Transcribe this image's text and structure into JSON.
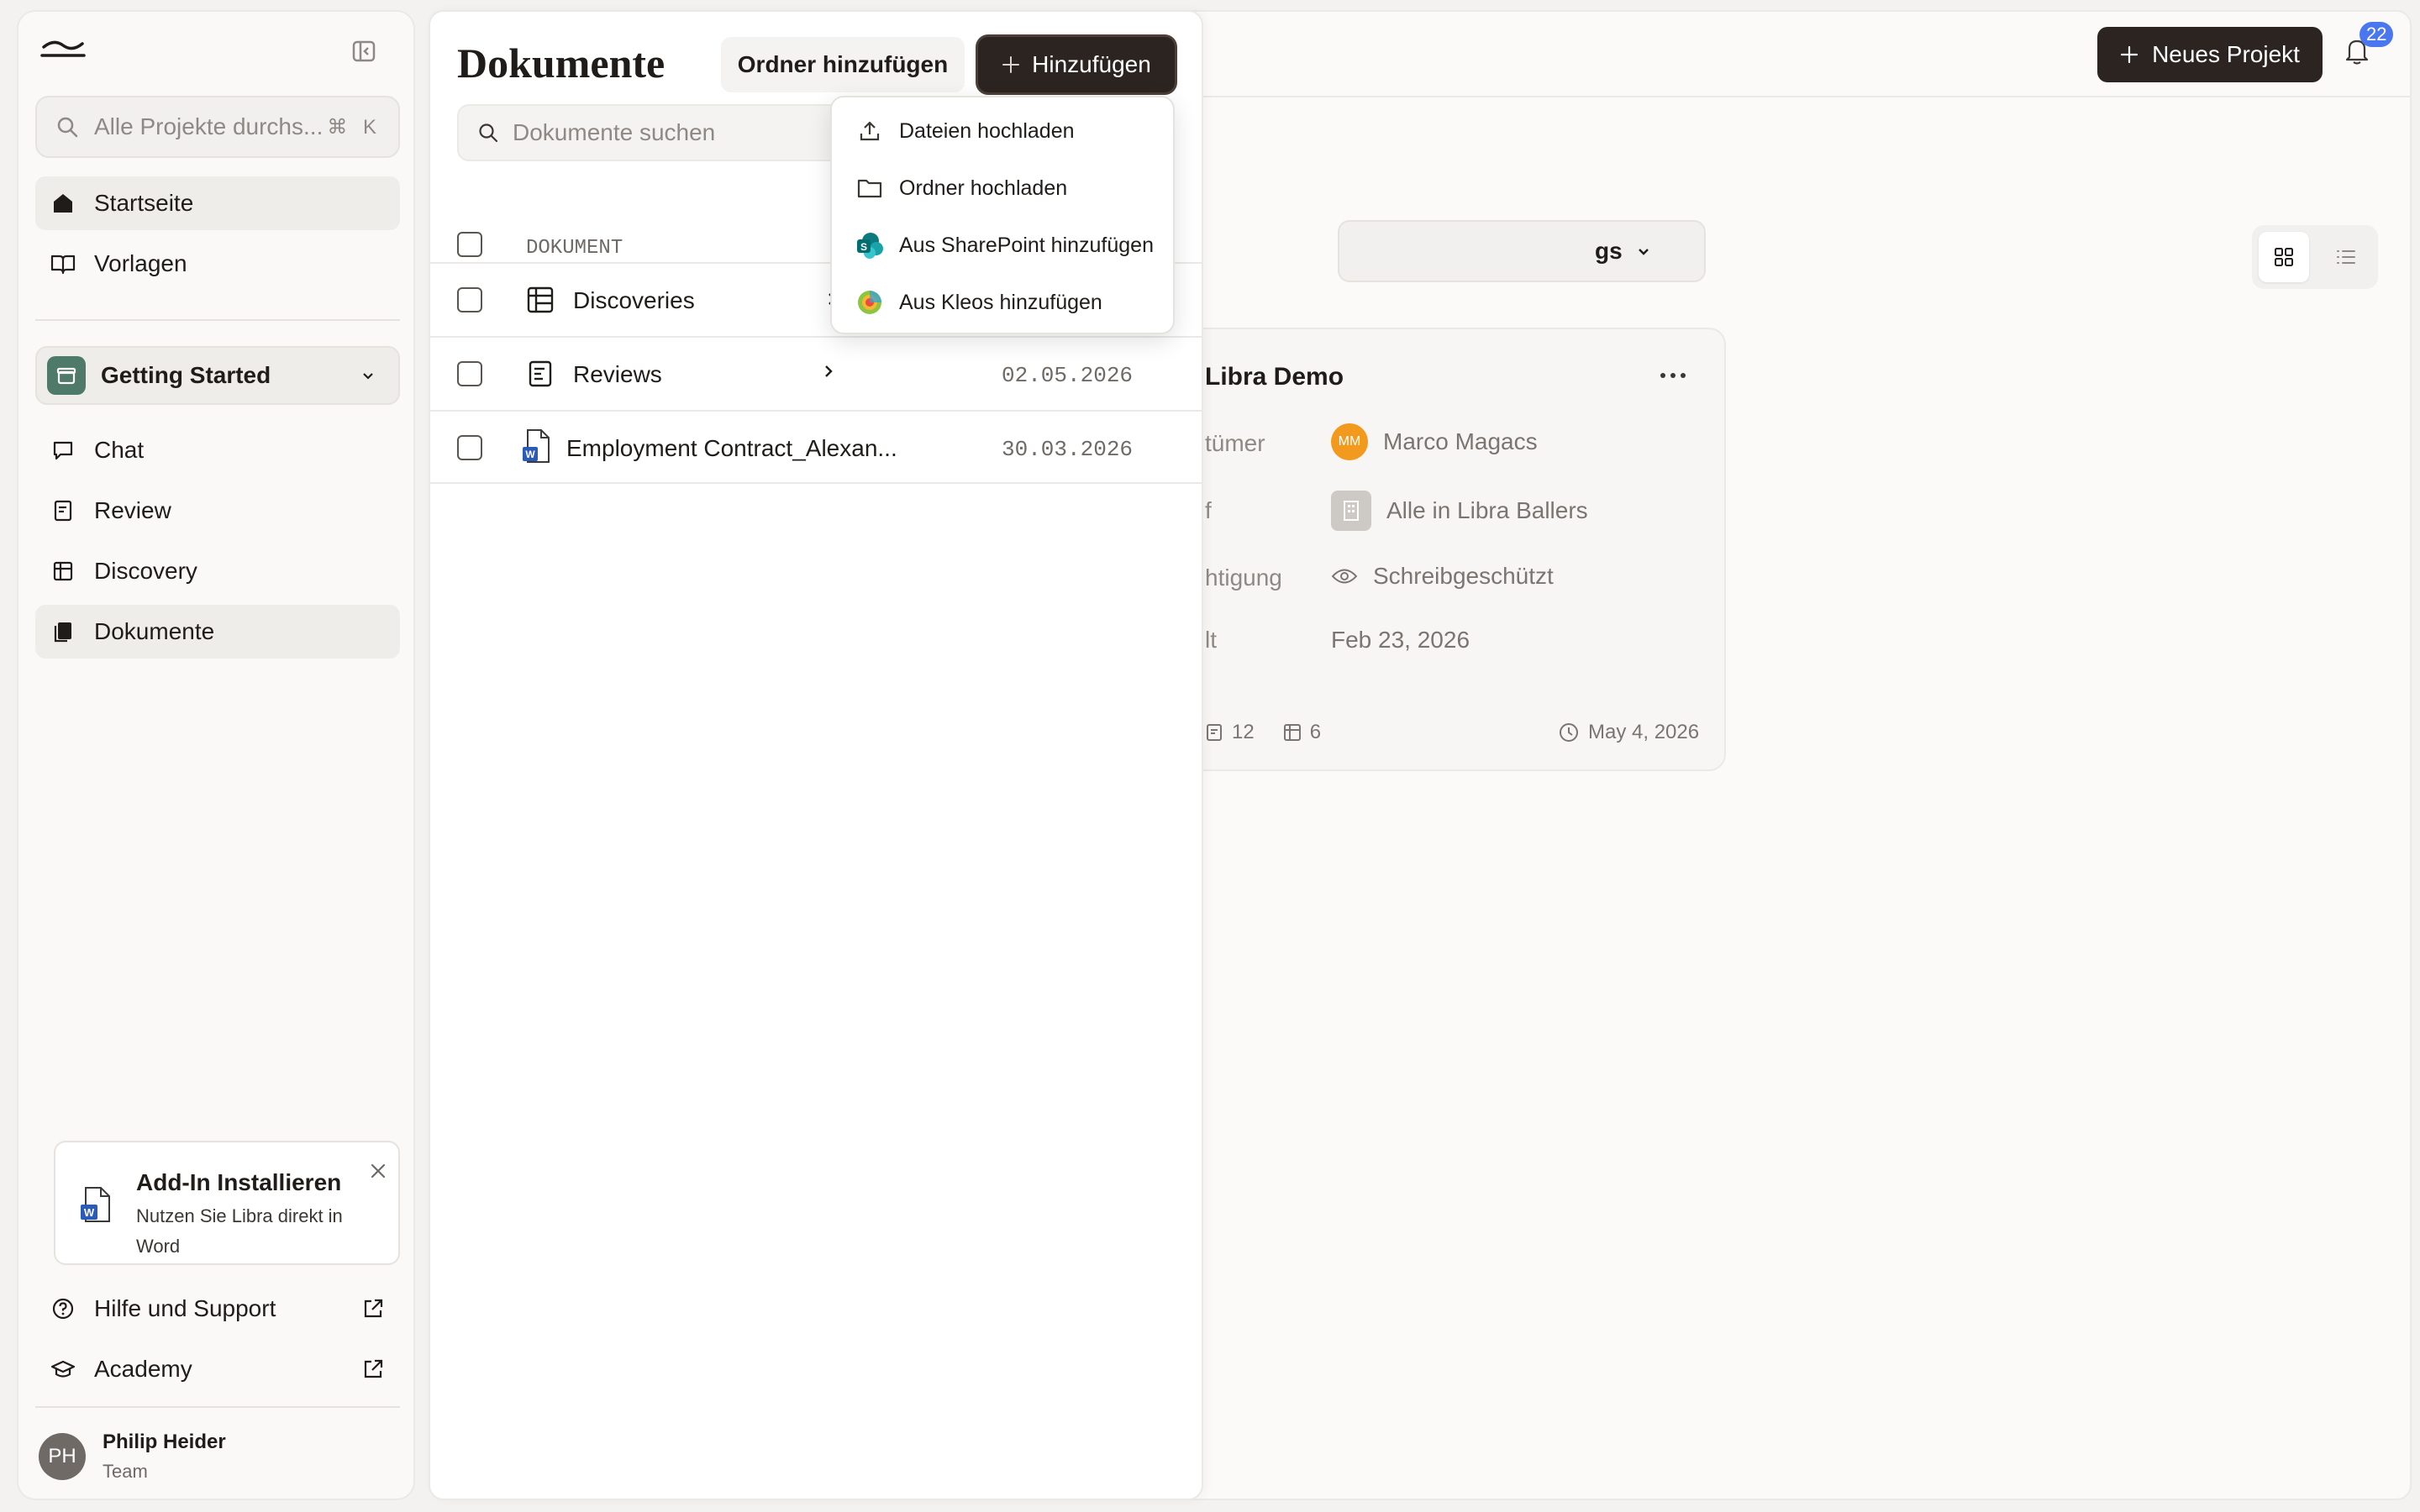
{
  "sidebar": {
    "search": {
      "placeholder": "Alle Projekte durchs...",
      "shortcut": "⌘ K"
    },
    "nav": [
      {
        "label": "Startseite",
        "icon": "home-icon",
        "active": true
      },
      {
        "label": "Vorlagen",
        "icon": "book-icon",
        "active": false
      }
    ],
    "project": {
      "label": "Getting Started",
      "icon": "project-box-icon"
    },
    "project_nav": [
      {
        "label": "Chat",
        "icon": "chat-icon"
      },
      {
        "label": "Review",
        "icon": "review-icon"
      },
      {
        "label": "Discovery",
        "icon": "table-icon"
      },
      {
        "label": "Dokumente",
        "icon": "documents-icon",
        "active": true
      }
    ],
    "addin": {
      "title": "Add-In Installieren",
      "description": "Nutzen Sie Libra direkt in Word"
    },
    "footer": [
      {
        "label": "Hilfe und Support",
        "icon": "help-icon"
      },
      {
        "label": "Academy",
        "icon": "academy-icon"
      }
    ],
    "user": {
      "initials": "PH",
      "name": "Philip Heider",
      "role": "Team"
    }
  },
  "header": {
    "new_project_label": "Neues Projekt",
    "notification_count": "22"
  },
  "project_card": {
    "filter_label": "gs",
    "title": "Libra Demo",
    "rows": [
      {
        "label": "tümer",
        "value": "Marco Magacs",
        "avatar": "MM"
      },
      {
        "label": "f",
        "value": "Alle in Libra Ballers"
      },
      {
        "label": "htigung",
        "value": "Schreibgeschützt"
      },
      {
        "label": "lt",
        "value": "Feb 23, 2026"
      }
    ],
    "reviews_count": "12",
    "tables_count": "6",
    "updated": "May 4, 2026"
  },
  "documents": {
    "title": "Dokumente",
    "add_folder_label": "Ordner hinzufügen",
    "add_label": "Hinzufügen",
    "search_placeholder": "Dokumente suchen",
    "column_header": "DOKUMENT",
    "rows": [
      {
        "name": "Discoveries",
        "date": "",
        "icon": "table-icon",
        "expandable": true
      },
      {
        "name": "Reviews",
        "date": "02.05.2026",
        "icon": "review-icon",
        "expandable": true
      },
      {
        "name": "Employment Contract_Alexan...",
        "date": "30.03.2026",
        "icon": "word-file-icon",
        "expandable": false
      }
    ]
  },
  "add_menu": {
    "items": [
      {
        "label": "Dateien hochladen",
        "icon": "upload-icon"
      },
      {
        "label": "Ordner hochladen",
        "icon": "folder-icon"
      },
      {
        "label": "Aus SharePoint hinzufügen",
        "icon": "sharepoint-icon"
      },
      {
        "label": "Aus Kleos hinzufügen",
        "icon": "kleos-icon"
      }
    ]
  },
  "colors": {
    "accent_dark": "#2b2420",
    "project_badge": "#4f7a6a",
    "notification_badge": "#4a76f0",
    "owner_avatar": "#f29a1e"
  }
}
